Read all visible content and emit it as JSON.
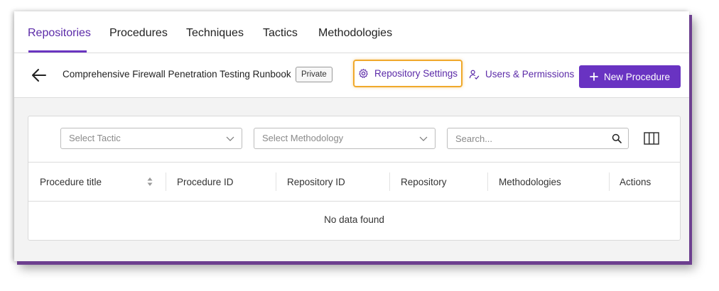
{
  "tabs": [
    {
      "label": "Repositories",
      "active": true
    },
    {
      "label": "Procedures"
    },
    {
      "label": "Techniques"
    },
    {
      "label": "Tactics"
    },
    {
      "label": "Methodologies"
    }
  ],
  "toolbar": {
    "repo_title": "Comprehensive Firewall Penetration Testing Runbook",
    "visibility_badge": "Private",
    "settings_label": "Repository Settings",
    "users_label": "Users & Permissions",
    "new_label": "New Procedure"
  },
  "filters": {
    "tactic_placeholder": "Select Tactic",
    "methodology_placeholder": "Select Methodology",
    "search_placeholder": "Search..."
  },
  "table": {
    "columns": [
      "Procedure title",
      "Procedure ID",
      "Repository ID",
      "Repository",
      "Methodologies",
      "Actions"
    ],
    "empty_text": "No data found"
  },
  "colors": {
    "accent": "#6933c2",
    "highlight": "#f0a92c"
  }
}
